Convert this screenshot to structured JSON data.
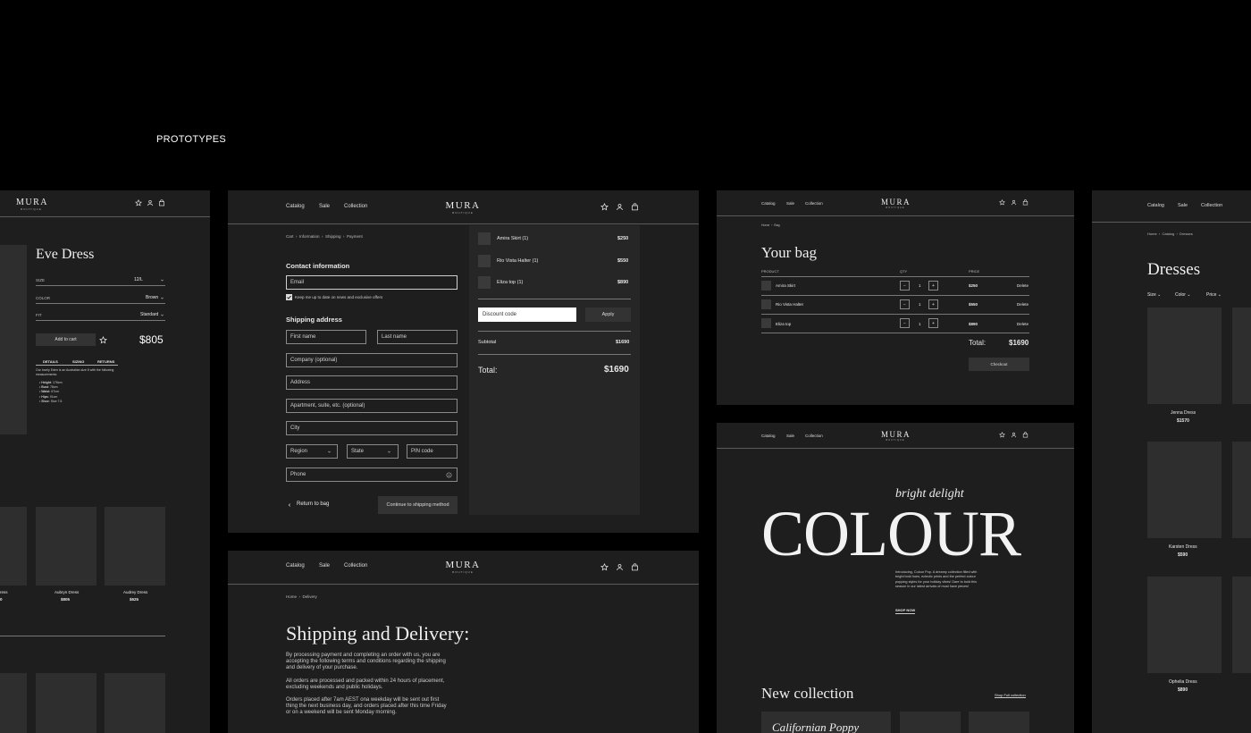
{
  "page": {
    "section_title": "PROTOTYPES"
  },
  "brand": {
    "logo": "MURA",
    "logo_sub": "BOUTIQUE"
  },
  "nav": {
    "catalog": "Catalog",
    "sale": "Sale",
    "collection": "Collection"
  },
  "product": {
    "title": "Eve Dress",
    "size_label": "SIZE",
    "size_value": "12/L",
    "color_label": "COLOR",
    "color_value": "Brown",
    "fit_label": "FIT",
    "fit_value": "Standard",
    "add_to_cart": "Add to cart",
    "price": "$805",
    "tabs": [
      "DETAILS",
      "SIZING",
      "RETURNS"
    ],
    "description": "Our lovely Eden is an Australian size 8 with the following measurements:",
    "measurements": [
      {
        "label": "Height",
        "value": "176cm"
      },
      {
        "label": "Bust",
        "value": "78cm"
      },
      {
        "label": "Waist",
        "value": "67cm"
      },
      {
        "label": "Hips",
        "value": "91cm"
      },
      {
        "label": "Shoe",
        "value": "Size 7.5"
      }
    ],
    "related": [
      {
        "name": "ress",
        "price": "0"
      },
      {
        "name": "Aubryn Dress",
        "price": "$805"
      },
      {
        "name": "Audrey Dress",
        "price": "$625"
      }
    ]
  },
  "checkout": {
    "breadcrumb": [
      "Cart",
      "Information",
      "Shipping",
      "Payment"
    ],
    "contact_heading": "Contact information",
    "email_placeholder": "Email",
    "newsletter_label": "Keep me up to date on news and exclusive offers",
    "shipping_heading": "Shipping address",
    "first_name": "First name",
    "last_name": "Last name",
    "company": "Company (optional)",
    "address": "Address",
    "apartment": "Apartment, suite, etc. (optional)",
    "city": "City",
    "region": "Region",
    "state": "State",
    "pin": "PIN code",
    "phone": "Phone",
    "return_link": "Return to bag",
    "continue_button": "Continue to shipping method",
    "items": [
      {
        "name": "Amira Skirt (1)",
        "price": "$250"
      },
      {
        "name": "Rio Vista Halter (1)",
        "price": "$550"
      },
      {
        "name": "Eliza top (1)",
        "price": "$890"
      }
    ],
    "discount_placeholder": "Discount code",
    "apply_button": "Apply",
    "subtotal_label": "Subtotal",
    "subtotal_value": "$1690",
    "total_label": "Total:",
    "total_value": "$1690"
  },
  "shipping_page": {
    "breadcrumb": [
      "Home",
      "Delivery"
    ],
    "title": "Shipping and Delivery:",
    "paragraphs": [
      "By processing payment and completing an order with us, you are accepting the following terms and conditions regarding the shipping and delivery of your purchase.",
      "All orders are processed and packed within 24 hours of placement, excluding weekends and public holidays.",
      "Orders placed after 7am AEST ona weekday will be sent out first thing the next business day, and orders placed after this time Friday or on a weekend will be sent Monday morning."
    ]
  },
  "bag": {
    "breadcrumb": [
      "Home",
      "Bag"
    ],
    "title": "Your bag",
    "col_product": "PRODUCT",
    "col_qty": "QTY",
    "col_price": "PRICE",
    "items": [
      {
        "name": "Amira Skirt",
        "qty": "1",
        "price": "$250",
        "delete": "Delete"
      },
      {
        "name": "Rio Vista Halter",
        "qty": "1",
        "price": "$550",
        "delete": "Delete"
      },
      {
        "name": "Eliza top",
        "qty": "1",
        "price": "$890",
        "delete": "Delete"
      }
    ],
    "total_label": "Total:",
    "total_value": "$1690",
    "checkout_button": "Checkout"
  },
  "home": {
    "tagline": "bright delight",
    "hero": "COLOUR",
    "intro": "Introducing, Colour Pop. A dreamy collection filled with bright bold hues, eclectic prints and the perfect colour popping styles for your holiday vibes! Dare to bold this season in our latest arrivals of must have pieces!",
    "shop_now": "SHOP NOW",
    "new_collection": "New collection",
    "shop_full": "Shop Full collection",
    "card_title": "Californian Poppy"
  },
  "dresses": {
    "breadcrumb": [
      "Home",
      "Catalog",
      "Dresses"
    ],
    "title": "Dresses",
    "filters": [
      "Size",
      "Color",
      "Price"
    ],
    "items": [
      {
        "name": "Jenna Dress",
        "price": "$1570"
      },
      {
        "name": "Karsten Dress",
        "price": "$590"
      },
      {
        "name": "Ophelia Dress",
        "price": "$890"
      }
    ]
  },
  "icons": [
    "star-icon",
    "user-icon",
    "bag-icon",
    "check-icon",
    "chevron-down-icon",
    "chevron-left-icon",
    "info-icon"
  ]
}
